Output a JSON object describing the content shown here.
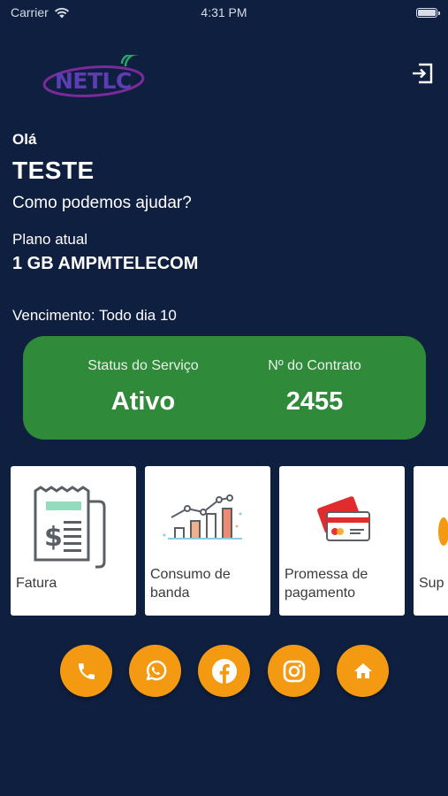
{
  "status_bar": {
    "carrier": "Carrier",
    "time": "4:31 PM"
  },
  "header": {
    "logo_text": "NETLC",
    "logout_icon": "exit-icon"
  },
  "greeting": {
    "hello": "Olá",
    "user_name": "TESTE",
    "prompt": "Como podemos ajudar?"
  },
  "plan": {
    "label": "Plano atual",
    "name": "1 GB AMPMTELECOM",
    "due": "Vencimento: Todo dia 10"
  },
  "service_card": {
    "status_label": "Status do Serviço",
    "status_value": "Ativo",
    "contract_label": "Nº do Contrato",
    "contract_value": "2455",
    "color": "#2f8a3a"
  },
  "tiles": [
    {
      "label": "Fatura",
      "icon": "invoice-icon"
    },
    {
      "label": "Consumo de banda",
      "icon": "bar-chart-icon"
    },
    {
      "label": "Promessa de pagamento",
      "icon": "credit-card-icon"
    },
    {
      "label": "Sup",
      "icon": "support-icon"
    }
  ],
  "actions": [
    {
      "icon": "phone-icon"
    },
    {
      "icon": "whatsapp-icon"
    },
    {
      "icon": "facebook-icon"
    },
    {
      "icon": "instagram-icon"
    },
    {
      "icon": "home-icon"
    }
  ],
  "colors": {
    "background": "#0f1f40",
    "accent": "#f39a12",
    "card_green": "#2f8a3a"
  }
}
